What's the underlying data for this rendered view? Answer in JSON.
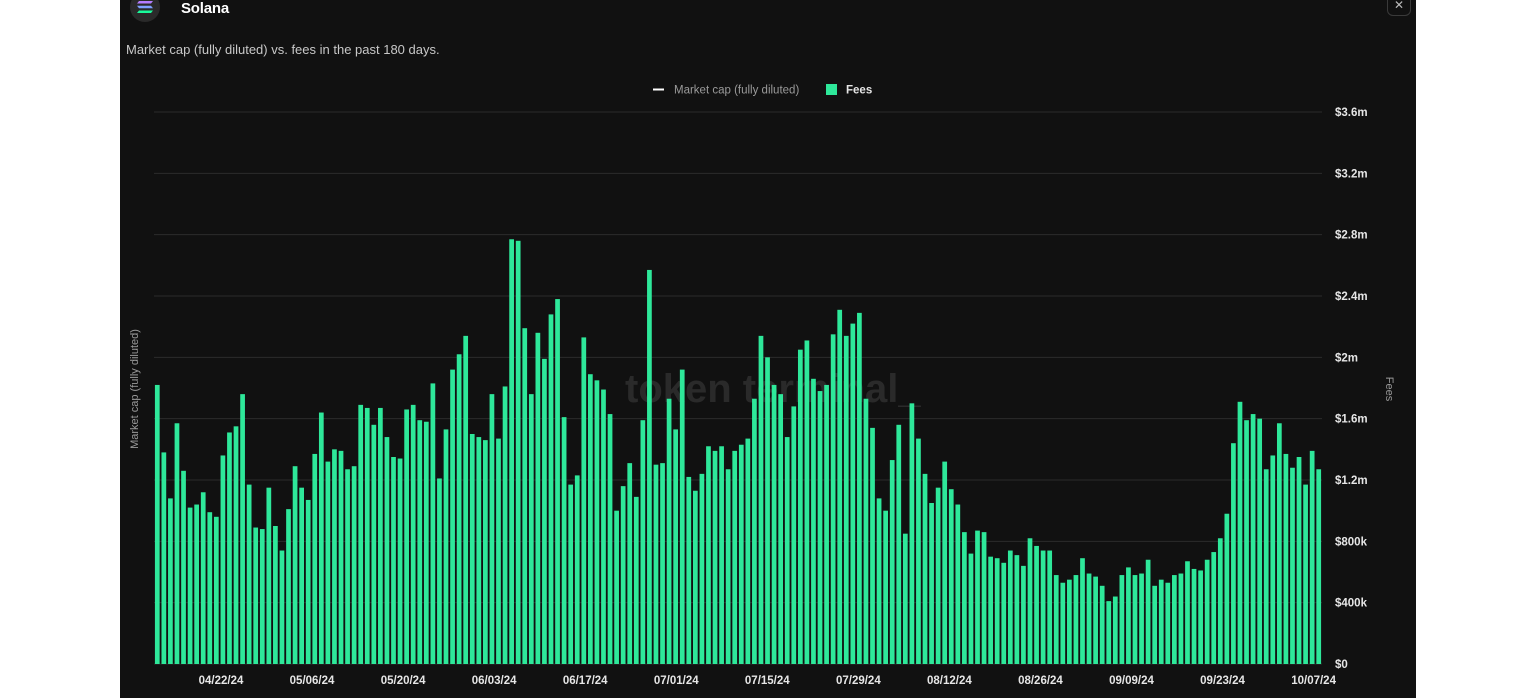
{
  "header": {
    "title": "Solana",
    "subtitle": "Market cap (fully diluted) vs. fees in the past 180 days.",
    "close_icon": "close-icon",
    "logo_icon": "solana-logo-icon"
  },
  "colors": {
    "background": "#111111",
    "fees": "#2ee89a",
    "grid": "#2c2c2c",
    "text": "#e6e6e6",
    "muted": "#9a9a9a",
    "market_cap_line": "#ffffff"
  },
  "watermark": "token terminal_",
  "chart_data": {
    "type": "bar",
    "title": "",
    "legend": [
      "Market cap (fully diluted)",
      "Fees"
    ],
    "legend_placement": "top-center",
    "grid": true,
    "ylabel_left": "Market cap (fully diluted)",
    "ylabel_right": "Fees",
    "y_ticks": [
      "$0",
      "$400k",
      "$800k",
      "$1.2m",
      "$1.6m",
      "$2m",
      "$2.4m",
      "$2.8m",
      "$3.2m",
      "$3.6m"
    ],
    "ylim": [
      0,
      3600000
    ],
    "x_ticks": [
      "04/22/24",
      "05/06/24",
      "05/20/24",
      "06/03/24",
      "06/17/24",
      "07/01/24",
      "07/15/24",
      "07/29/24",
      "08/12/24",
      "08/26/24",
      "09/09/24",
      "09/23/24",
      "10/07/24"
    ],
    "series": [
      {
        "name": "Fees",
        "values": [
          1820000,
          1380000,
          1080000,
          1570000,
          1260000,
          1020000,
          1040000,
          1120000,
          990000,
          960000,
          1360000,
          1510000,
          1550000,
          1760000,
          1170000,
          890000,
          880000,
          1150000,
          900000,
          740000,
          1010000,
          1290000,
          1150000,
          1070000,
          1370000,
          1640000,
          1320000,
          1400000,
          1390000,
          1270000,
          1290000,
          1690000,
          1670000,
          1560000,
          1670000,
          1480000,
          1350000,
          1340000,
          1660000,
          1690000,
          1590000,
          1580000,
          1830000,
          1210000,
          1530000,
          1920000,
          2020000,
          2140000,
          1500000,
          1480000,
          1460000,
          1760000,
          1470000,
          1810000,
          2770000,
          2760000,
          2190000,
          1760000,
          2160000,
          1990000,
          2280000,
          2380000,
          1610000,
          1170000,
          1230000,
          2130000,
          1890000,
          1850000,
          1790000,
          1630000,
          1000000,
          1160000,
          1310000,
          1090000,
          1590000,
          2570000,
          1300000,
          1310000,
          1730000,
          1530000,
          1920000,
          1220000,
          1130000,
          1240000,
          1420000,
          1390000,
          1420000,
          1270000,
          1390000,
          1430000,
          1470000,
          1730000,
          2140000,
          2000000,
          1820000,
          1760000,
          1480000,
          1680000,
          2050000,
          2110000,
          1860000,
          1780000,
          1820000,
          2150000,
          2310000,
          2140000,
          2220000,
          2290000,
          1730000,
          1540000,
          1080000,
          1000000,
          1330000,
          1560000,
          850000,
          1700000,
          1470000,
          1240000,
          1050000,
          1150000,
          1320000,
          1140000,
          1040000,
          860000,
          720000,
          870000,
          860000,
          700000,
          690000,
          660000,
          740000,
          710000,
          640000,
          820000,
          770000,
          740000,
          740000,
          580000,
          530000,
          550000,
          580000,
          690000,
          590000,
          570000,
          510000,
          410000,
          440000,
          580000,
          630000,
          580000,
          590000,
          680000,
          510000,
          550000,
          530000,
          580000,
          590000,
          670000,
          620000,
          610000,
          680000,
          730000,
          820000,
          980000,
          1440000,
          1710000,
          1590000,
          1630000,
          1600000,
          1270000,
          1360000,
          1570000,
          1370000,
          1280000,
          1350000,
          1170000,
          1390000,
          1270000
        ]
      }
    ]
  }
}
